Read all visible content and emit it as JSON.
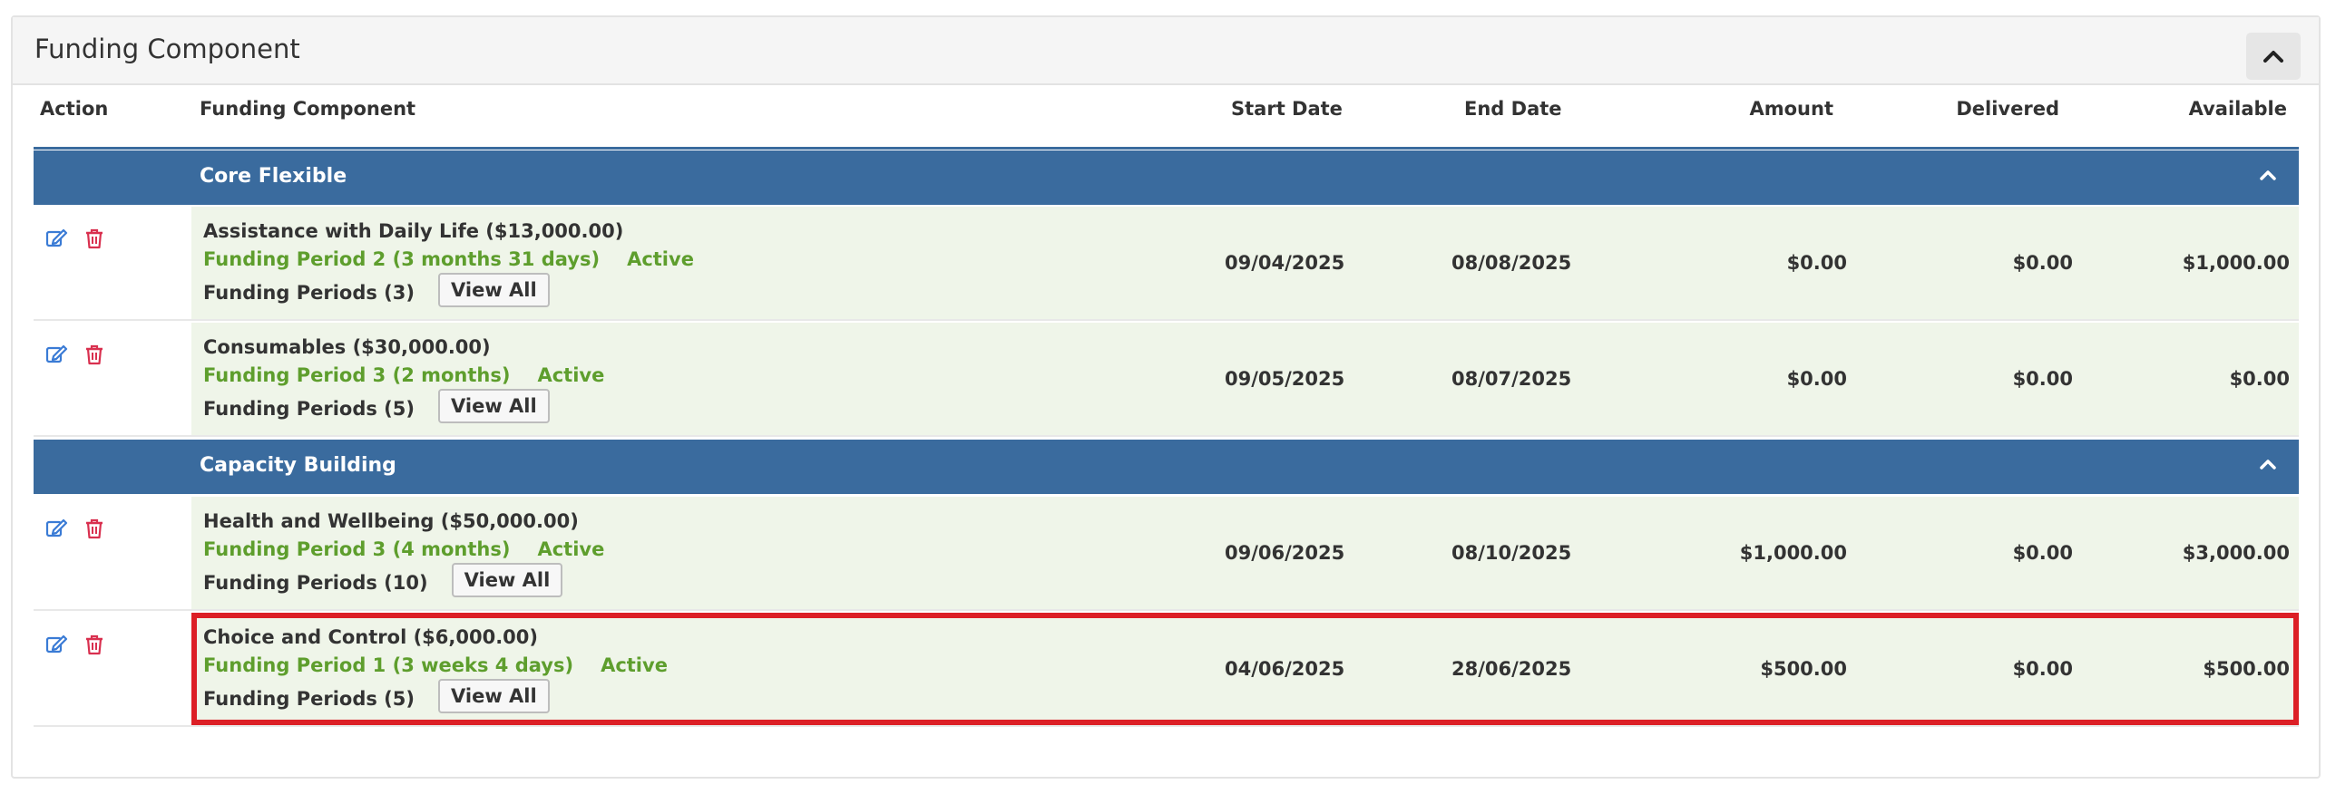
{
  "panel": {
    "title": "Funding Component"
  },
  "columns": {
    "action": "Action",
    "funding_component": "Funding Component",
    "start_date": "Start Date",
    "end_date": "End Date",
    "amount": "Amount",
    "delivered": "Delivered",
    "available": "Available"
  },
  "groups": [
    {
      "label": "Core Flexible",
      "rows": [
        {
          "name": "Assistance with Daily Life ($13,000.00)",
          "period": "Funding Period 2 (3 months 31 days)",
          "status": "Active",
          "periods": "Funding Periods (3)",
          "view_all": "View All",
          "start_date": "09/04/2025",
          "end_date": "08/08/2025",
          "amount": "$0.00",
          "delivered": "$0.00",
          "available": "$1,000.00"
        },
        {
          "name": "Consumables ($30,000.00)",
          "period": "Funding Period 3 (2 months)",
          "status": "Active",
          "periods": "Funding Periods (5)",
          "view_all": "View All",
          "start_date": "09/05/2025",
          "end_date": "08/07/2025",
          "amount": "$0.00",
          "delivered": "$0.00",
          "available": "$0.00"
        }
      ]
    },
    {
      "label": "Capacity Building",
      "rows": [
        {
          "name": "Health and Wellbeing ($50,000.00)",
          "period": "Funding Period 3 (4 months)",
          "status": "Active",
          "periods": "Funding Periods (10)",
          "view_all": "View All",
          "start_date": "09/06/2025",
          "end_date": "08/10/2025",
          "amount": "$1,000.00",
          "delivered": "$0.00",
          "available": "$3,000.00"
        },
        {
          "name": "Choice and Control ($6,000.00)",
          "period": "Funding Period 1 (3 weeks 4 days)",
          "status": "Active",
          "periods": "Funding Periods (5)",
          "view_all": "View All",
          "start_date": "04/06/2025",
          "end_date": "28/06/2025",
          "amount": "$500.00",
          "delivered": "$0.00",
          "available": "$500.00"
        }
      ]
    }
  ],
  "icons": {
    "edit": "edit-icon",
    "delete": "trash-icon",
    "collapse": "chevron-up-icon"
  },
  "colors": {
    "group_header": "#3a6b9e",
    "active_green": "#5e9e2d",
    "row_tint": "#eff5e9",
    "edit_blue": "#3a7bd5",
    "delete_red": "#d9304f",
    "highlight_red": "#dc1f26"
  }
}
